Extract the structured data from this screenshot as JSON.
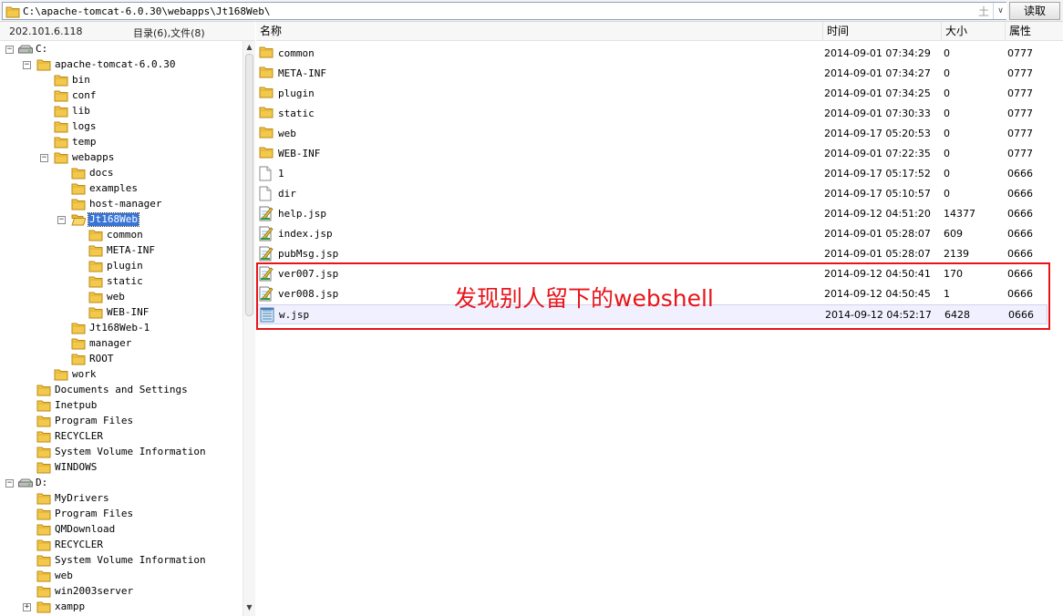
{
  "address_bar": {
    "path": "C:\\apache-tomcat-6.0.30\\webapps\\Jt168Web\\",
    "plus_glyph": "土",
    "dropdown_glyph": "∨",
    "read_button": "读取"
  },
  "left_header": {
    "ip": "202.101.6.118",
    "counts": "目录(6),文件(8)"
  },
  "tree": [
    {
      "label": "C:",
      "depth": 0,
      "toggle": "−",
      "icon": "drive-icon"
    },
    {
      "label": "apache-tomcat-6.0.30",
      "depth": 1,
      "toggle": "−",
      "icon": "folder-icon"
    },
    {
      "label": "bin",
      "depth": 2,
      "toggle": "",
      "icon": "folder-icon"
    },
    {
      "label": "conf",
      "depth": 2,
      "toggle": "",
      "icon": "folder-icon"
    },
    {
      "label": "lib",
      "depth": 2,
      "toggle": "",
      "icon": "folder-icon"
    },
    {
      "label": "logs",
      "depth": 2,
      "toggle": "",
      "icon": "folder-icon"
    },
    {
      "label": "temp",
      "depth": 2,
      "toggle": "",
      "icon": "folder-icon"
    },
    {
      "label": "webapps",
      "depth": 2,
      "toggle": "−",
      "icon": "folder-icon"
    },
    {
      "label": "docs",
      "depth": 3,
      "toggle": "",
      "icon": "folder-icon"
    },
    {
      "label": "examples",
      "depth": 3,
      "toggle": "",
      "icon": "folder-icon"
    },
    {
      "label": "host-manager",
      "depth": 3,
      "toggle": "",
      "icon": "folder-icon"
    },
    {
      "label": "Jt168Web",
      "depth": 3,
      "toggle": "−",
      "icon": "folder-open-icon",
      "selected": true
    },
    {
      "label": "common",
      "depth": 4,
      "toggle": "",
      "icon": "folder-icon"
    },
    {
      "label": "META-INF",
      "depth": 4,
      "toggle": "",
      "icon": "folder-icon"
    },
    {
      "label": "plugin",
      "depth": 4,
      "toggle": "",
      "icon": "folder-icon"
    },
    {
      "label": "static",
      "depth": 4,
      "toggle": "",
      "icon": "folder-icon"
    },
    {
      "label": "web",
      "depth": 4,
      "toggle": "",
      "icon": "folder-icon"
    },
    {
      "label": "WEB-INF",
      "depth": 4,
      "toggle": "",
      "icon": "folder-icon"
    },
    {
      "label": "Jt168Web-1",
      "depth": 3,
      "toggle": "",
      "icon": "folder-icon"
    },
    {
      "label": "manager",
      "depth": 3,
      "toggle": "",
      "icon": "folder-icon"
    },
    {
      "label": "ROOT",
      "depth": 3,
      "toggle": "",
      "icon": "folder-icon"
    },
    {
      "label": "work",
      "depth": 2,
      "toggle": "",
      "icon": "folder-icon"
    },
    {
      "label": "Documents and Settings",
      "depth": 1,
      "toggle": "",
      "icon": "folder-icon"
    },
    {
      "label": "Inetpub",
      "depth": 1,
      "toggle": "",
      "icon": "folder-icon"
    },
    {
      "label": "Program Files",
      "depth": 1,
      "toggle": "",
      "icon": "folder-icon"
    },
    {
      "label": "RECYCLER",
      "depth": 1,
      "toggle": "",
      "icon": "folder-icon"
    },
    {
      "label": "System Volume Information",
      "depth": 1,
      "toggle": "",
      "icon": "folder-icon"
    },
    {
      "label": "WINDOWS",
      "depth": 1,
      "toggle": "",
      "icon": "folder-icon"
    },
    {
      "label": "D:",
      "depth": 0,
      "toggle": "−",
      "icon": "drive-icon"
    },
    {
      "label": "MyDrivers",
      "depth": 1,
      "toggle": "",
      "icon": "folder-icon"
    },
    {
      "label": "Program Files",
      "depth": 1,
      "toggle": "",
      "icon": "folder-icon"
    },
    {
      "label": "QMDownload",
      "depth": 1,
      "toggle": "",
      "icon": "folder-icon"
    },
    {
      "label": "RECYCLER",
      "depth": 1,
      "toggle": "",
      "icon": "folder-icon"
    },
    {
      "label": "System Volume Information",
      "depth": 1,
      "toggle": "",
      "icon": "folder-icon"
    },
    {
      "label": "web",
      "depth": 1,
      "toggle": "",
      "icon": "folder-icon"
    },
    {
      "label": "win2003server",
      "depth": 1,
      "toggle": "",
      "icon": "folder-icon"
    },
    {
      "label": "xampp",
      "depth": 1,
      "toggle": "+",
      "icon": "folder-icon"
    }
  ],
  "columns": {
    "name": "名称",
    "time": "时间",
    "size": "大小",
    "attr": "属性"
  },
  "files": [
    {
      "name": "common",
      "time": "2014-09-01 07:34:29",
      "size": "0",
      "attr": "0777",
      "icon": "folder-icon"
    },
    {
      "name": "META-INF",
      "time": "2014-09-01 07:34:27",
      "size": "0",
      "attr": "0777",
      "icon": "folder-icon"
    },
    {
      "name": "plugin",
      "time": "2014-09-01 07:34:25",
      "size": "0",
      "attr": "0777",
      "icon": "folder-icon"
    },
    {
      "name": "static",
      "time": "2014-09-01 07:30:33",
      "size": "0",
      "attr": "0777",
      "icon": "folder-icon"
    },
    {
      "name": "web",
      "time": "2014-09-17 05:20:53",
      "size": "0",
      "attr": "0777",
      "icon": "folder-icon"
    },
    {
      "name": "WEB-INF",
      "time": "2014-09-01 07:22:35",
      "size": "0",
      "attr": "0777",
      "icon": "folder-icon"
    },
    {
      "name": "1",
      "time": "2014-09-17 05:17:52",
      "size": "0",
      "attr": "0666",
      "icon": "blank-file-icon"
    },
    {
      "name": "dir",
      "time": "2014-09-17 05:10:57",
      "size": "0",
      "attr": "0666",
      "icon": "blank-file-icon"
    },
    {
      "name": "help.jsp",
      "time": "2014-09-12 04:51:20",
      "size": "14377",
      "attr": "0666",
      "icon": "jsp-file-icon"
    },
    {
      "name": "index.jsp",
      "time": "2014-09-01 05:28:07",
      "size": "609",
      "attr": "0666",
      "icon": "jsp-file-icon"
    },
    {
      "name": "pubMsg.jsp",
      "time": "2014-09-01 05:28:07",
      "size": "2139",
      "attr": "0666",
      "icon": "jsp-file-icon"
    },
    {
      "name": "ver007.jsp",
      "time": "2014-09-12 04:50:41",
      "size": "170",
      "attr": "0666",
      "icon": "jsp-file-icon"
    },
    {
      "name": "ver008.jsp",
      "time": "2014-09-12 04:50:45",
      "size": "1",
      "attr": "0666",
      "icon": "jsp-file-icon"
    },
    {
      "name": "w.jsp",
      "time": "2014-09-12 04:52:17",
      "size": "6428",
      "attr": "0666",
      "icon": "script-file-icon",
      "highlighted": true
    }
  ],
  "annotation": {
    "text": "发现别人留下的webshell",
    "color": "#e8141b"
  },
  "colors": {
    "selection": "#3875d7",
    "folder": "#f2c94c",
    "annotation_box": "#e8141b"
  }
}
